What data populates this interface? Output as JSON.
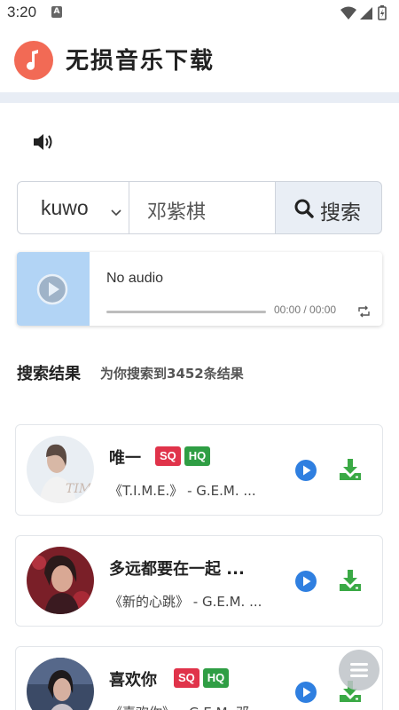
{
  "status_bar": {
    "time": "3:20",
    "notification_letter": "A",
    "icons": [
      "wifi-icon",
      "signal-icon",
      "battery-icon"
    ]
  },
  "app": {
    "title": "无损音乐下载",
    "logo_icon": "music-note-icon",
    "accent_color": "#f26a55"
  },
  "volume_icon": "speaker-volume-icon",
  "search": {
    "source": "kuwo",
    "query": "邓紫棋",
    "button_label": "搜索"
  },
  "player": {
    "status": "No audio",
    "time": "00:00 / 00:00",
    "progress": 0
  },
  "results": {
    "title": "搜索结果",
    "count_text": "为你搜索到3452条结果",
    "items": [
      {
        "title": "唯一",
        "tags": [
          "SQ",
          "HQ"
        ],
        "album": "《T.I.M.E.》 - G.E.M. ..."
      },
      {
        "title": "多远都要在一起 ...",
        "tags": [],
        "album": "《新的心跳》 - G.E.M. ..."
      },
      {
        "title": "喜欢你",
        "tags": [
          "SQ",
          "HQ"
        ],
        "album": "《喜欢你》 - G.E.M. 邓..."
      }
    ]
  },
  "colors": {
    "tag_sq": "#e0334a",
    "tag_hq": "#2f9e44",
    "play": "#2f7fe0",
    "download": "#3aa945"
  }
}
